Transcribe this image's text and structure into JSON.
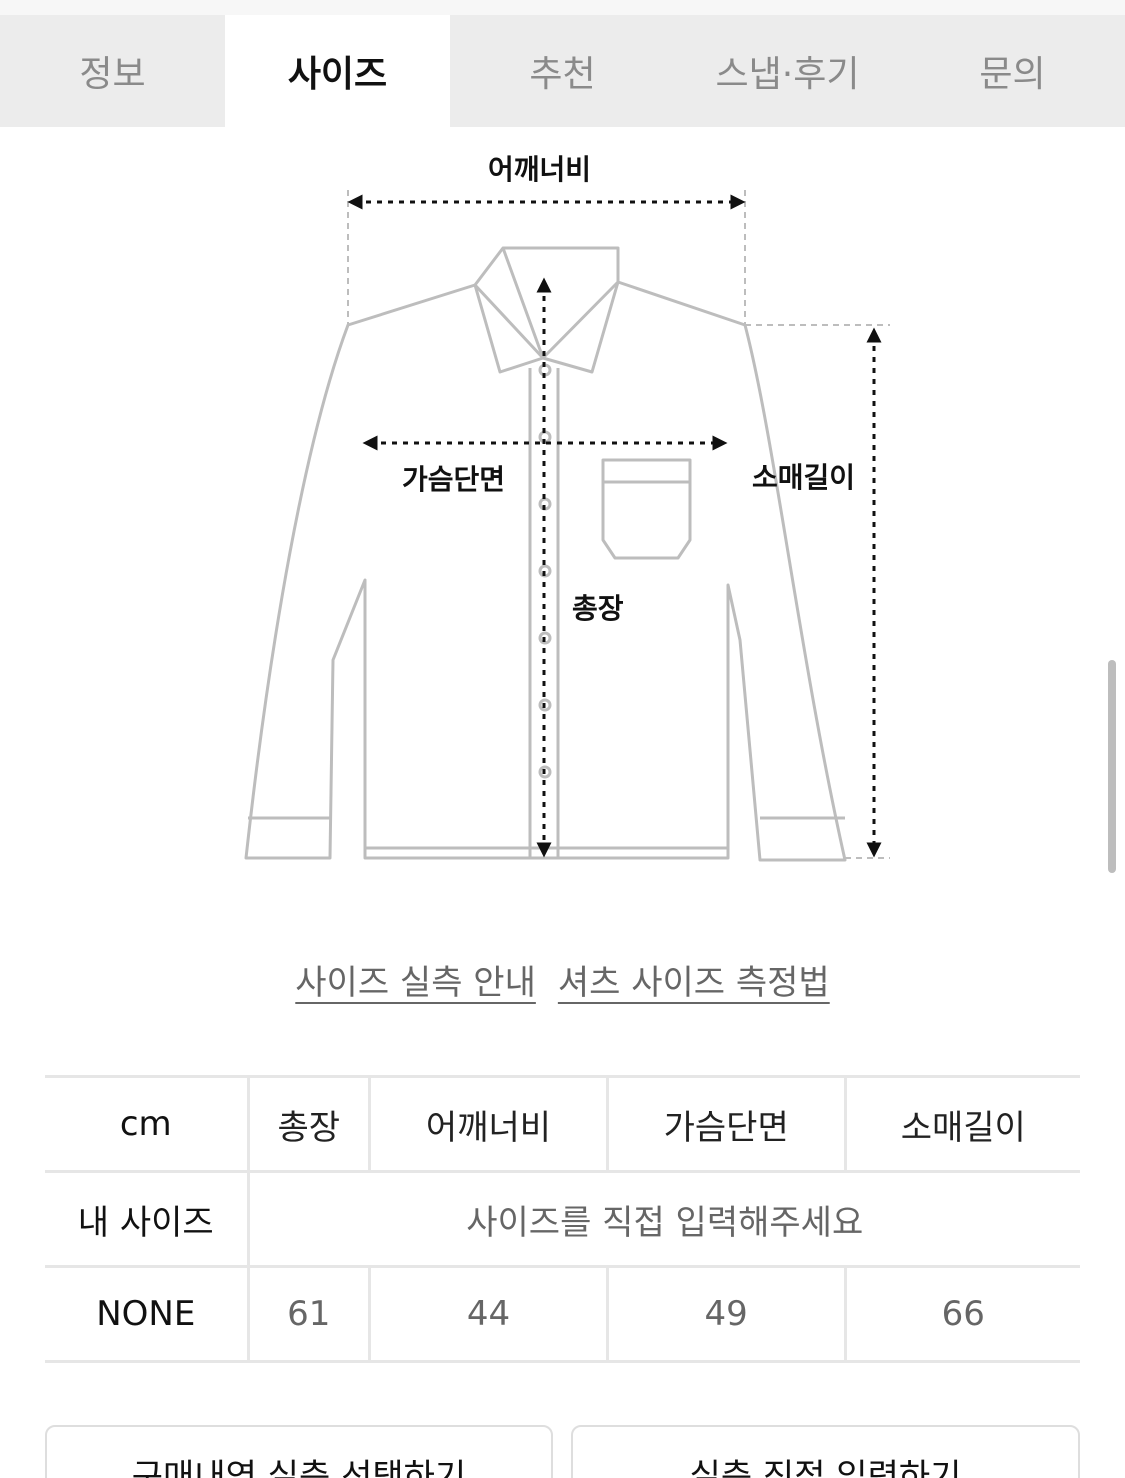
{
  "tabs": [
    {
      "label": "정보",
      "active": false
    },
    {
      "label": "사이즈",
      "active": true
    },
    {
      "label": "추천",
      "active": false
    },
    {
      "label": "스냅·후기",
      "active": false
    },
    {
      "label": "문의",
      "active": false
    }
  ],
  "diagram": {
    "shoulder": "어깨너비",
    "chest": "가슴단면",
    "length": "총장",
    "sleeve": "소매길이"
  },
  "links": {
    "guide": "사이즈 실측 안내",
    "method": "셔츠 사이즈 측정법"
  },
  "table": {
    "header": [
      "cm",
      "총장",
      "어깨너비",
      "가슴단면",
      "소매길이"
    ],
    "my_size_label": "내 사이즈",
    "my_size_placeholder": "사이즈를 직접 입력해주세요",
    "rows": [
      {
        "name": "NONE",
        "values": [
          "61",
          "44",
          "49",
          "66"
        ]
      }
    ]
  },
  "buttons": {
    "select_purchase": "구매내역 실측 선택하기",
    "direct_input": "실측 직접 입력하기"
  },
  "colors": {
    "tab_bg": "#ececec",
    "outline": "#bdbdbd",
    "arrow": "#111111"
  }
}
